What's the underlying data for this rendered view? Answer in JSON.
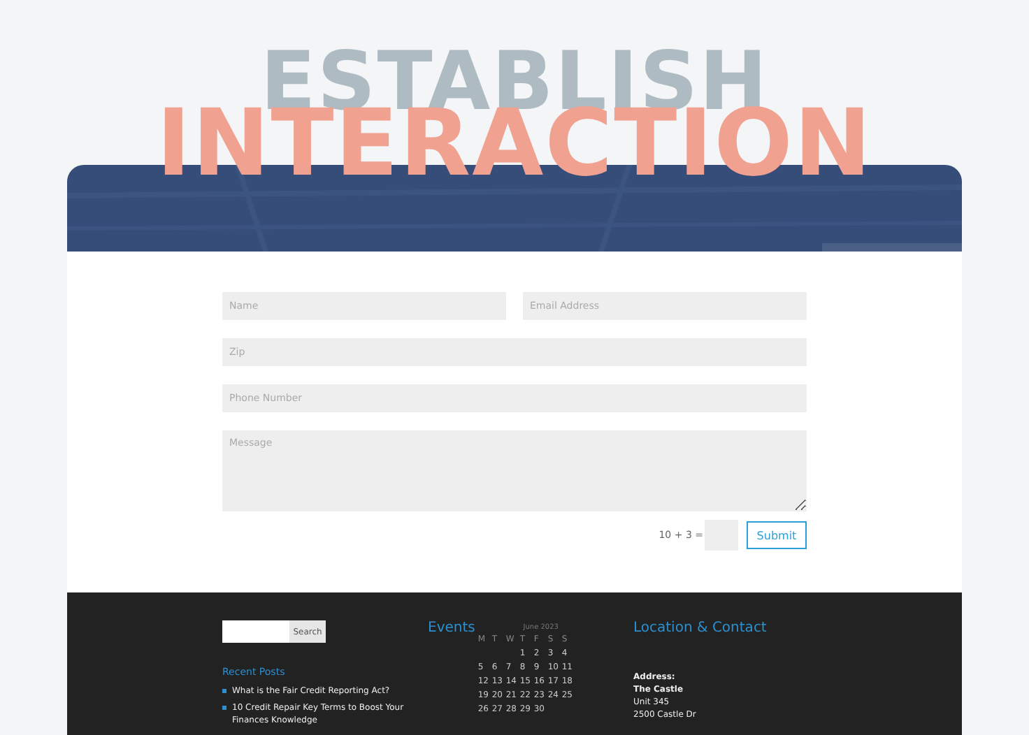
{
  "headline": {
    "top": "ESTABLISH",
    "bottom": "INTERACTION"
  },
  "form": {
    "fields": [
      {
        "placeholder": "Name",
        "kind": "half"
      },
      {
        "placeholder": "Email Address",
        "kind": "half"
      },
      {
        "placeholder": "Zip",
        "kind": "full"
      },
      {
        "placeholder": "Phone Number",
        "kind": "full"
      },
      {
        "placeholder": "Message",
        "kind": "area"
      }
    ],
    "captcha": "10 + 3 =",
    "submit": "Submit"
  },
  "footer": {
    "search_button": "Search",
    "recent_posts": {
      "title": "Recent Posts",
      "items": [
        "What is the Fair Credit Reporting Act?",
        "10 Credit Repair Key Terms to Boost Your Finances Knowledge"
      ]
    },
    "events": {
      "title": "Events",
      "month": "June 2023",
      "weekdays": [
        "M",
        "T",
        "W",
        "T",
        "F",
        "S",
        "S"
      ],
      "weeks": [
        {
          "kind": "first",
          "days": [
            "1",
            "2",
            "3",
            "4"
          ]
        },
        {
          "kind": "full",
          "days": [
            "5",
            "6",
            "7",
            "8",
            "9",
            "10",
            "11"
          ]
        },
        {
          "kind": "full",
          "days": [
            "12",
            "13",
            "14",
            "15",
            "16",
            "17",
            "18"
          ]
        },
        {
          "kind": "full",
          "days": [
            "19",
            "20",
            "21",
            "22",
            "23",
            "24",
            "25"
          ]
        },
        {
          "kind": "last",
          "days": [
            "26",
            "27",
            "28",
            "29",
            "30"
          ]
        }
      ]
    },
    "contact": {
      "title": "Location & Contact",
      "lines": [
        {
          "text": "Address:",
          "bold": true
        },
        {
          "text": "The Castle",
          "bold": true
        },
        {
          "text": "Unit 345",
          "bold": false
        },
        {
          "text": "2500 Castle Dr",
          "bold": false
        }
      ]
    }
  }
}
